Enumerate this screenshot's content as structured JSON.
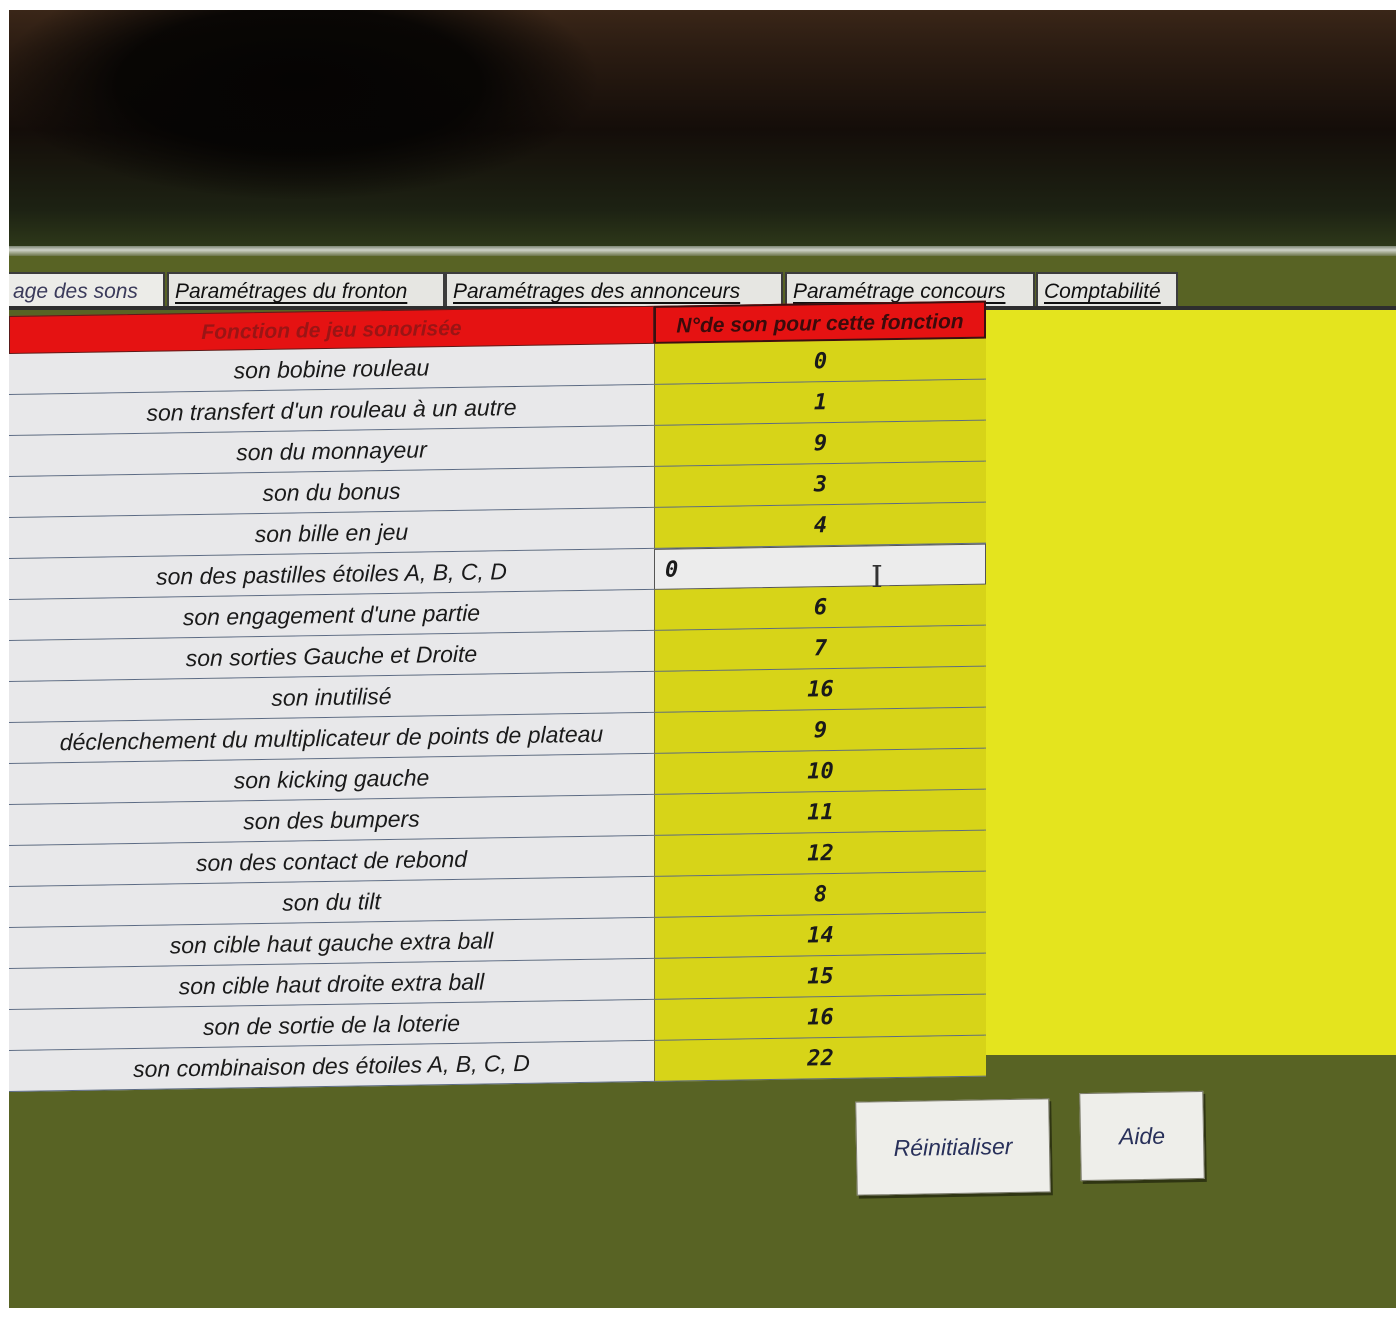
{
  "tabs": [
    {
      "label": "age des sons",
      "active": true
    },
    {
      "label": "Paramétrages du fronton",
      "active": false
    },
    {
      "label": "Paramétrages des annonceurs",
      "active": false
    },
    {
      "label": "Paramétrage concours",
      "active": false
    },
    {
      "label": "Comptabilité",
      "active": false
    }
  ],
  "table": {
    "headers": [
      "Fonction de jeu sonorisée",
      "N°de son pour cette fonction"
    ],
    "rows": [
      {
        "label": "son bobine rouleau",
        "value": "0"
      },
      {
        "label": "son transfert d'un rouleau à un autre",
        "value": "1"
      },
      {
        "label": "son du monnayeur",
        "value": "9"
      },
      {
        "label": "son du bonus",
        "value": "3"
      },
      {
        "label": "son bille en jeu",
        "value": "4"
      },
      {
        "label": "son des pastilles étoiles A, B, C, D",
        "value": "0",
        "editing": true
      },
      {
        "label": "son engagement d'une partie",
        "value": "6"
      },
      {
        "label": "son sorties Gauche et Droite",
        "value": "7"
      },
      {
        "label": "son inutilisé",
        "value": "16"
      },
      {
        "label": "déclenchement du multiplicateur de points de plateau",
        "value": "9"
      },
      {
        "label": "son kicking gauche",
        "value": "10"
      },
      {
        "label": "son des bumpers",
        "value": "11"
      },
      {
        "label": "son des contact de rebond",
        "value": "12"
      },
      {
        "label": "son du tilt",
        "value": "8"
      },
      {
        "label": "son cible haut gauche extra ball",
        "value": "14"
      },
      {
        "label": "son cible haut droite extra ball",
        "value": "15"
      },
      {
        "label": "son de sortie de la loterie",
        "value": "16"
      },
      {
        "label": "son combinaison des étoiles A, B, C, D",
        "value": "22"
      }
    ]
  },
  "buttons": {
    "reset_label": "Réinitialiser",
    "help_label": "Aide"
  },
  "colors": {
    "header_red": "#e51212",
    "cell_yellow": "#d7d418",
    "panel_yellow": "#e4e41e",
    "background_olive": "#586324"
  }
}
